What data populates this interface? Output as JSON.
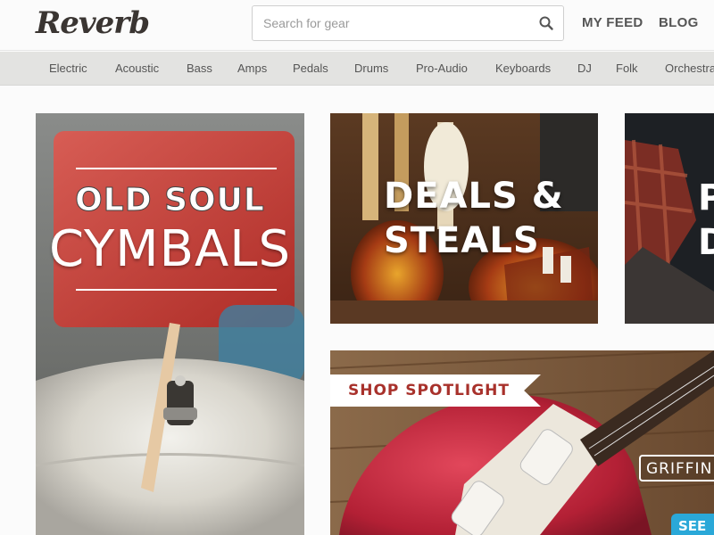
{
  "header": {
    "logo": "Reverb",
    "search_placeholder": "Search for gear",
    "nav": [
      "MY FEED",
      "BLOG"
    ]
  },
  "categories": [
    "Electric",
    "Acoustic",
    "Bass",
    "Amps",
    "Pedals",
    "Drums",
    "Pro-Audio",
    "Keyboards",
    "DJ",
    "Folk",
    "Orchestral"
  ],
  "tiles": {
    "cymbals": {
      "line1": "OLD SOUL",
      "line2": "CYMBALS"
    },
    "deals": {
      "line1": "DEALS &",
      "line2": "STEALS"
    },
    "partial": {
      "line1": "P",
      "line2": "D"
    },
    "spotlight": {
      "banner": "SHOP SPOTLIGHT",
      "brand": "GRIFFIN",
      "button": "SEE"
    }
  },
  "colors": {
    "brand_text": "#3a3532",
    "category_bar": "#e3e3e1",
    "spotlight_red": "#a8312b",
    "see_button": "#2aa8d8"
  }
}
